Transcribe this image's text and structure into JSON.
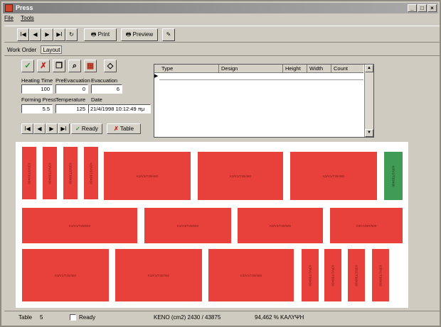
{
  "window": {
    "title": "Press"
  },
  "menu": {
    "file": "File",
    "tools": "Tools"
  },
  "toolbar": {
    "first": "I◀",
    "prev": "◀",
    "next": "▶",
    "last": "▶I",
    "refresh": "↻",
    "print": "Print",
    "preview": "Preview"
  },
  "tabs": {
    "work_order": "Work Order",
    "layout": "Layout"
  },
  "form": {
    "heating_time_label": "Heating Time",
    "pre_evacuation_label": "PreEvacuation",
    "evacuation_label": "Evacuation",
    "heating_time": "100",
    "pre_evacuation": "0",
    "evacuation": "6",
    "forming_press_label": "Forming Press",
    "temperature_label": "Temperature",
    "date_label": "Date",
    "forming_press": "5.5",
    "temperature": "125",
    "date": "21/4/1998 10:12:49 πμ"
  },
  "nav2": {
    "first": "I◀",
    "prev": "◀",
    "next": "▶",
    "last": "▶I",
    "ready": "Ready",
    "table": "Table"
  },
  "grid": {
    "columns": [
      "Type",
      "Design",
      "Height",
      "Width",
      "Count"
    ]
  },
  "layout": {
    "row1": [
      "K3/V3/T30/460",
      "K3/V2/T30/460",
      "K3/V3/T30/460",
      "K3/V3/T30/460",
      "K3/V2/T30/460",
      "K3/V1/T30/460",
      "K3/V1/T30/460",
      "K3/V1/T30/460"
    ],
    "row2": [
      "K3/V1/T80/500",
      "K3/V3/T30/500",
      "K3/V2/T30/500",
      "K3/V1/BR/500"
    ],
    "row3": [
      "K3/V1/T30/460",
      "K3/V1/T30/460",
      "K3/V1/T30/460",
      "K3/V1/T30/460",
      "K3/V1/T30/460",
      "K3/V1/T30/460",
      "K3/V1/T30/460"
    ]
  },
  "status": {
    "table_label": "Table",
    "table_number": "5",
    "ready_label": "Ready",
    "keno": "KENO (cm2)  2430 / 43875",
    "usage": "94,462  % ΚΑΛΥΨΗ"
  },
  "colors": {
    "part": "#e8403a",
    "selected_part": "#3f9b55"
  }
}
